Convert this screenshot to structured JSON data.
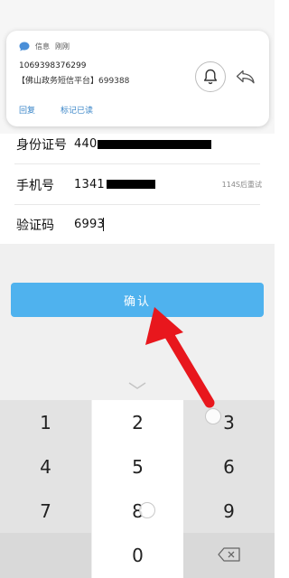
{
  "notification": {
    "app_name": "信息",
    "time": "刚刚",
    "sender": "1069398376299",
    "body": "【佛山政务短信平台】699388",
    "action_reply": "回复",
    "action_mark_read": "标记已读",
    "icons": {
      "app": "message-bubble-icon",
      "bell": "bell-icon",
      "reply": "reply-arrow-icon"
    }
  },
  "form": {
    "id_label": "身份证号",
    "id_value_visible": "440",
    "phone_label": "手机号",
    "phone_value_visible": "1341",
    "resend_text": "114S后重试",
    "code_label": "验证码",
    "code_value": "6993"
  },
  "confirm_button": {
    "label": "确认",
    "color": "#4fb2ee"
  },
  "keypad": {
    "keys": [
      "1",
      "2",
      "3",
      "4",
      "5",
      "6",
      "7",
      "8",
      "9",
      "",
      "0",
      ""
    ],
    "delete_icon": "backspace-icon",
    "collapse_icon": "chevron-down-icon"
  },
  "annotation": {
    "arrow_color": "#e8171d",
    "arrow_icon": "red-arrow-icon"
  }
}
